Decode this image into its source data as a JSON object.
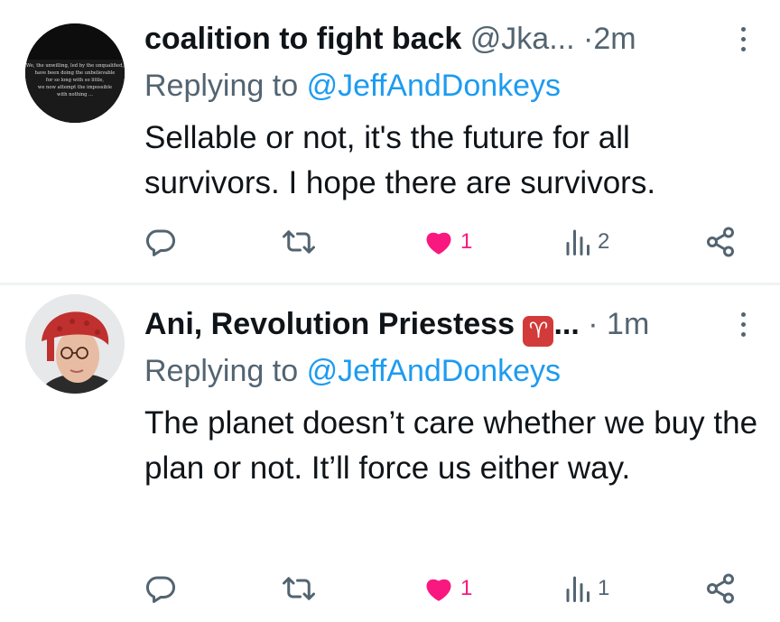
{
  "tweets": [
    {
      "author_name": "coalition to fight back",
      "author_handle": "@Jka...",
      "separator": "·",
      "time": "2m",
      "reply_prefix": "Replying to",
      "reply_to": "@JeffAndDonkeys",
      "text": "Sellable or not, it's the future for all survivors. I hope there are survivors.",
      "avatar_caption": "We, the unwilling, led by the unqualified, have been doing the unbelievable for so long with so little, we now attempt the impossible with nothing ...",
      "stats": {
        "likes": "1",
        "views": "2"
      },
      "liked": true
    },
    {
      "author_name": "Ani, Revolution Priestess",
      "name_emoji": "♈",
      "name_ellipsis": "...",
      "separator": "·",
      "time": "1m",
      "reply_prefix": "Replying to",
      "reply_to": "@JeffAndDonkeys",
      "text": "The planet doesn’t care whether we buy the plan or not. It’ll force us either way.",
      "stats": {
        "likes": "1",
        "views": "1"
      },
      "liked": true
    }
  ],
  "colors": {
    "text_primary": "#0f1419",
    "text_secondary": "#536471",
    "link": "#1d9bf0",
    "like_active": "#f91880",
    "divider": "#eff3f4"
  },
  "icons": [
    "reply-icon",
    "retweet-icon",
    "heart-filled-icon",
    "views-icon",
    "share-icon",
    "more-icon"
  ]
}
